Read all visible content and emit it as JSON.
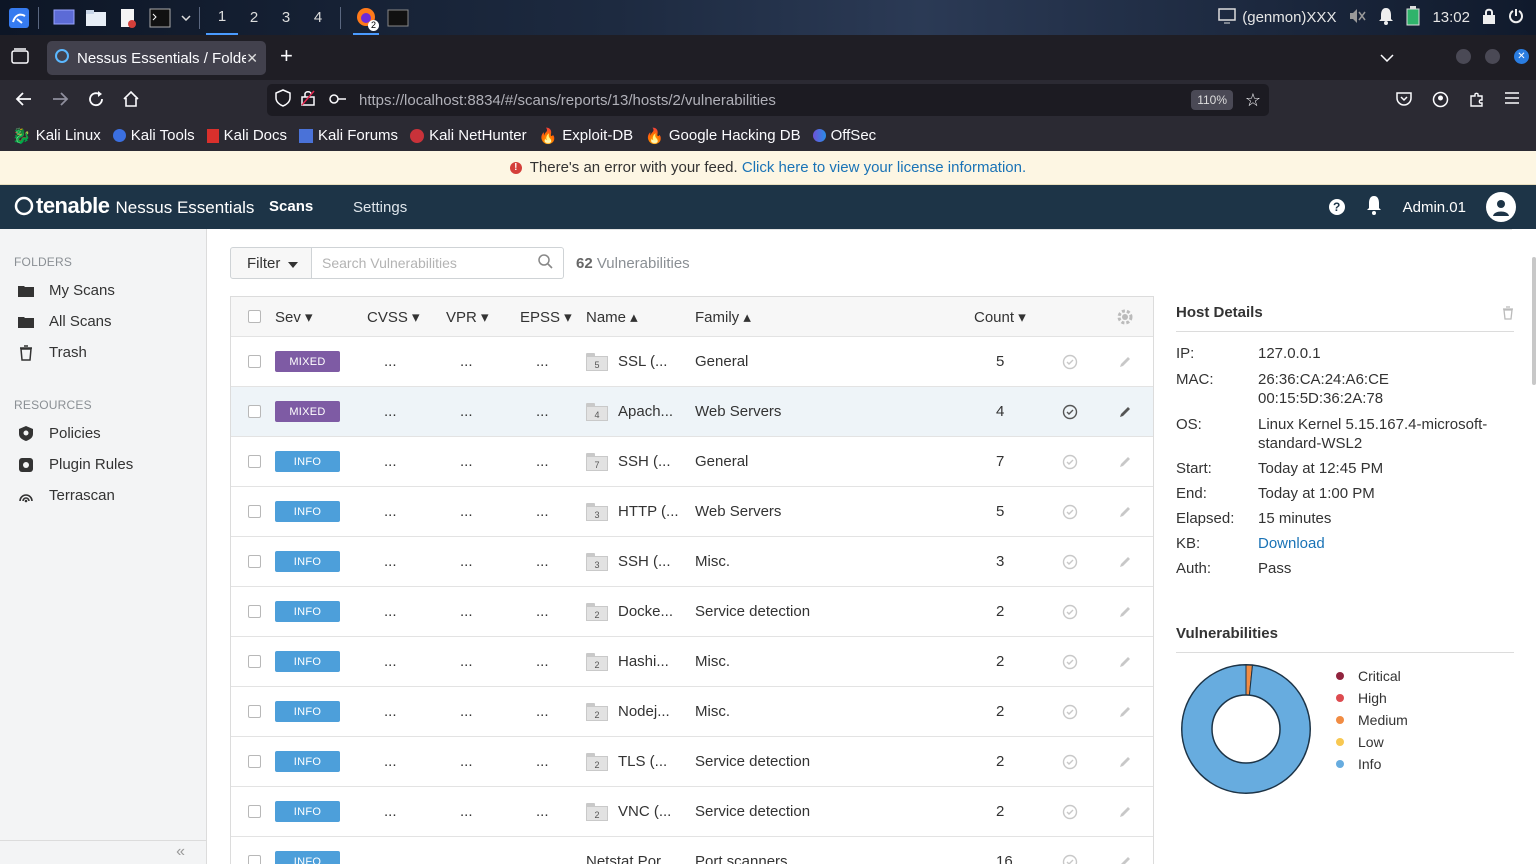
{
  "taskbar": {
    "workspaces": [
      "1",
      "2",
      "3",
      "4"
    ],
    "active_workspace": "1",
    "firefox_badge": "2",
    "genmon": "(genmon)XXX",
    "clock": "13:02"
  },
  "browser": {
    "tab_title": "Nessus Essentials / Folders / View Scan",
    "url": "https://localhost:8834/#/scans/reports/13/hosts/2/vulnerabilities",
    "zoom": "110%",
    "bookmarks": [
      "Kali Linux",
      "Kali Tools",
      "Kali Docs",
      "Kali Forums",
      "Kali NetHunter",
      "Exploit-DB",
      "Google Hacking DB",
      "OffSec"
    ]
  },
  "banner": {
    "text": "There's an error with your feed.",
    "link": "Click here to view your license information."
  },
  "header": {
    "brand": "tenable",
    "product": "Nessus Essentials",
    "nav_scans": "Scans",
    "nav_settings": "Settings",
    "user": "Admin.01"
  },
  "sidebar": {
    "folders_heading": "FOLDERS",
    "folders": [
      "My Scans",
      "All Scans",
      "Trash"
    ],
    "resources_heading": "RESOURCES",
    "resources": [
      "Policies",
      "Plugin Rules",
      "Terrascan"
    ]
  },
  "toolbar": {
    "filter_label": "Filter",
    "search_placeholder": "Search Vulnerabilities",
    "count_number": "62",
    "count_label": "Vulnerabilities"
  },
  "table": {
    "columns": {
      "sev": "Sev ▾",
      "cvss": "CVSS ▾",
      "vpr": "VPR ▾",
      "epss": "EPSS ▾",
      "name": "Name ▴",
      "family": "Family ▴",
      "count": "Count ▾"
    },
    "rows": [
      {
        "sev": "MIXED",
        "cvss": "...",
        "vpr": "...",
        "epss": "...",
        "group": "5",
        "name": "SSL (...",
        "family": "General",
        "count": "5"
      },
      {
        "sev": "MIXED",
        "cvss": "...",
        "vpr": "...",
        "epss": "...",
        "group": "4",
        "name": "Apach...",
        "family": "Web Servers",
        "count": "4"
      },
      {
        "sev": "INFO",
        "cvss": "...",
        "vpr": "...",
        "epss": "...",
        "group": "7",
        "name": "SSH (...",
        "family": "General",
        "count": "7"
      },
      {
        "sev": "INFO",
        "cvss": "...",
        "vpr": "...",
        "epss": "...",
        "group": "3",
        "name": "HTTP (...",
        "family": "Web Servers",
        "count": "5"
      },
      {
        "sev": "INFO",
        "cvss": "...",
        "vpr": "...",
        "epss": "...",
        "group": "3",
        "name": "SSH (...",
        "family": "Misc.",
        "count": "3"
      },
      {
        "sev": "INFO",
        "cvss": "...",
        "vpr": "...",
        "epss": "...",
        "group": "2",
        "name": "Docke...",
        "family": "Service detection",
        "count": "2"
      },
      {
        "sev": "INFO",
        "cvss": "...",
        "vpr": "...",
        "epss": "...",
        "group": "2",
        "name": "Hashi...",
        "family": "Misc.",
        "count": "2"
      },
      {
        "sev": "INFO",
        "cvss": "...",
        "vpr": "...",
        "epss": "...",
        "group": "2",
        "name": "Nodej...",
        "family": "Misc.",
        "count": "2"
      },
      {
        "sev": "INFO",
        "cvss": "...",
        "vpr": "...",
        "epss": "...",
        "group": "2",
        "name": "TLS (...",
        "family": "Service detection",
        "count": "2"
      },
      {
        "sev": "INFO",
        "cvss": "...",
        "vpr": "...",
        "epss": "...",
        "group": "2",
        "name": "VNC (...",
        "family": "Service detection",
        "count": "2"
      },
      {
        "sev": "INFO",
        "cvss": "",
        "vpr": "",
        "epss": "",
        "group": "",
        "name": "Netstat Por...",
        "family": "Port scanners",
        "count": "16"
      }
    ]
  },
  "host_details": {
    "title": "Host Details",
    "ip_label": "IP:",
    "ip": "127.0.0.1",
    "mac_label": "MAC:",
    "mac1": "26:36:CA:24:A6:CE",
    "mac2": "00:15:5D:36:2A:78",
    "os_label": "OS:",
    "os1": "Linux Kernel 5.15.167.4-microsoft-",
    "os2": "standard-WSL2",
    "start_label": "Start:",
    "start": "Today at 12:45 PM",
    "end_label": "End:",
    "end": "Today at 1:00 PM",
    "elapsed_label": "Elapsed:",
    "elapsed": "15 minutes",
    "kb_label": "KB:",
    "kb": "Download",
    "auth_label": "Auth:",
    "auth": "Pass"
  },
  "vulnerabilities_panel": {
    "title": "Vulnerabilities",
    "legend": [
      {
        "label": "Critical",
        "color": "#91243e"
      },
      {
        "label": "High",
        "color": "#dd4b50"
      },
      {
        "label": "Medium",
        "color": "#f18c43"
      },
      {
        "label": "Low",
        "color": "#f8c851"
      },
      {
        "label": "Info",
        "color": "#67acdf"
      }
    ],
    "chart_data": {
      "type": "pie",
      "labels": [
        "Critical",
        "High",
        "Medium",
        "Low",
        "Info"
      ],
      "values": [
        0,
        0,
        1,
        0,
        61
      ]
    }
  },
  "colors": {
    "header_bg": "#1d3447",
    "mixed_badge": "#7e5ba4",
    "info_badge": "#4d9fda",
    "link": "#1a73b6"
  }
}
